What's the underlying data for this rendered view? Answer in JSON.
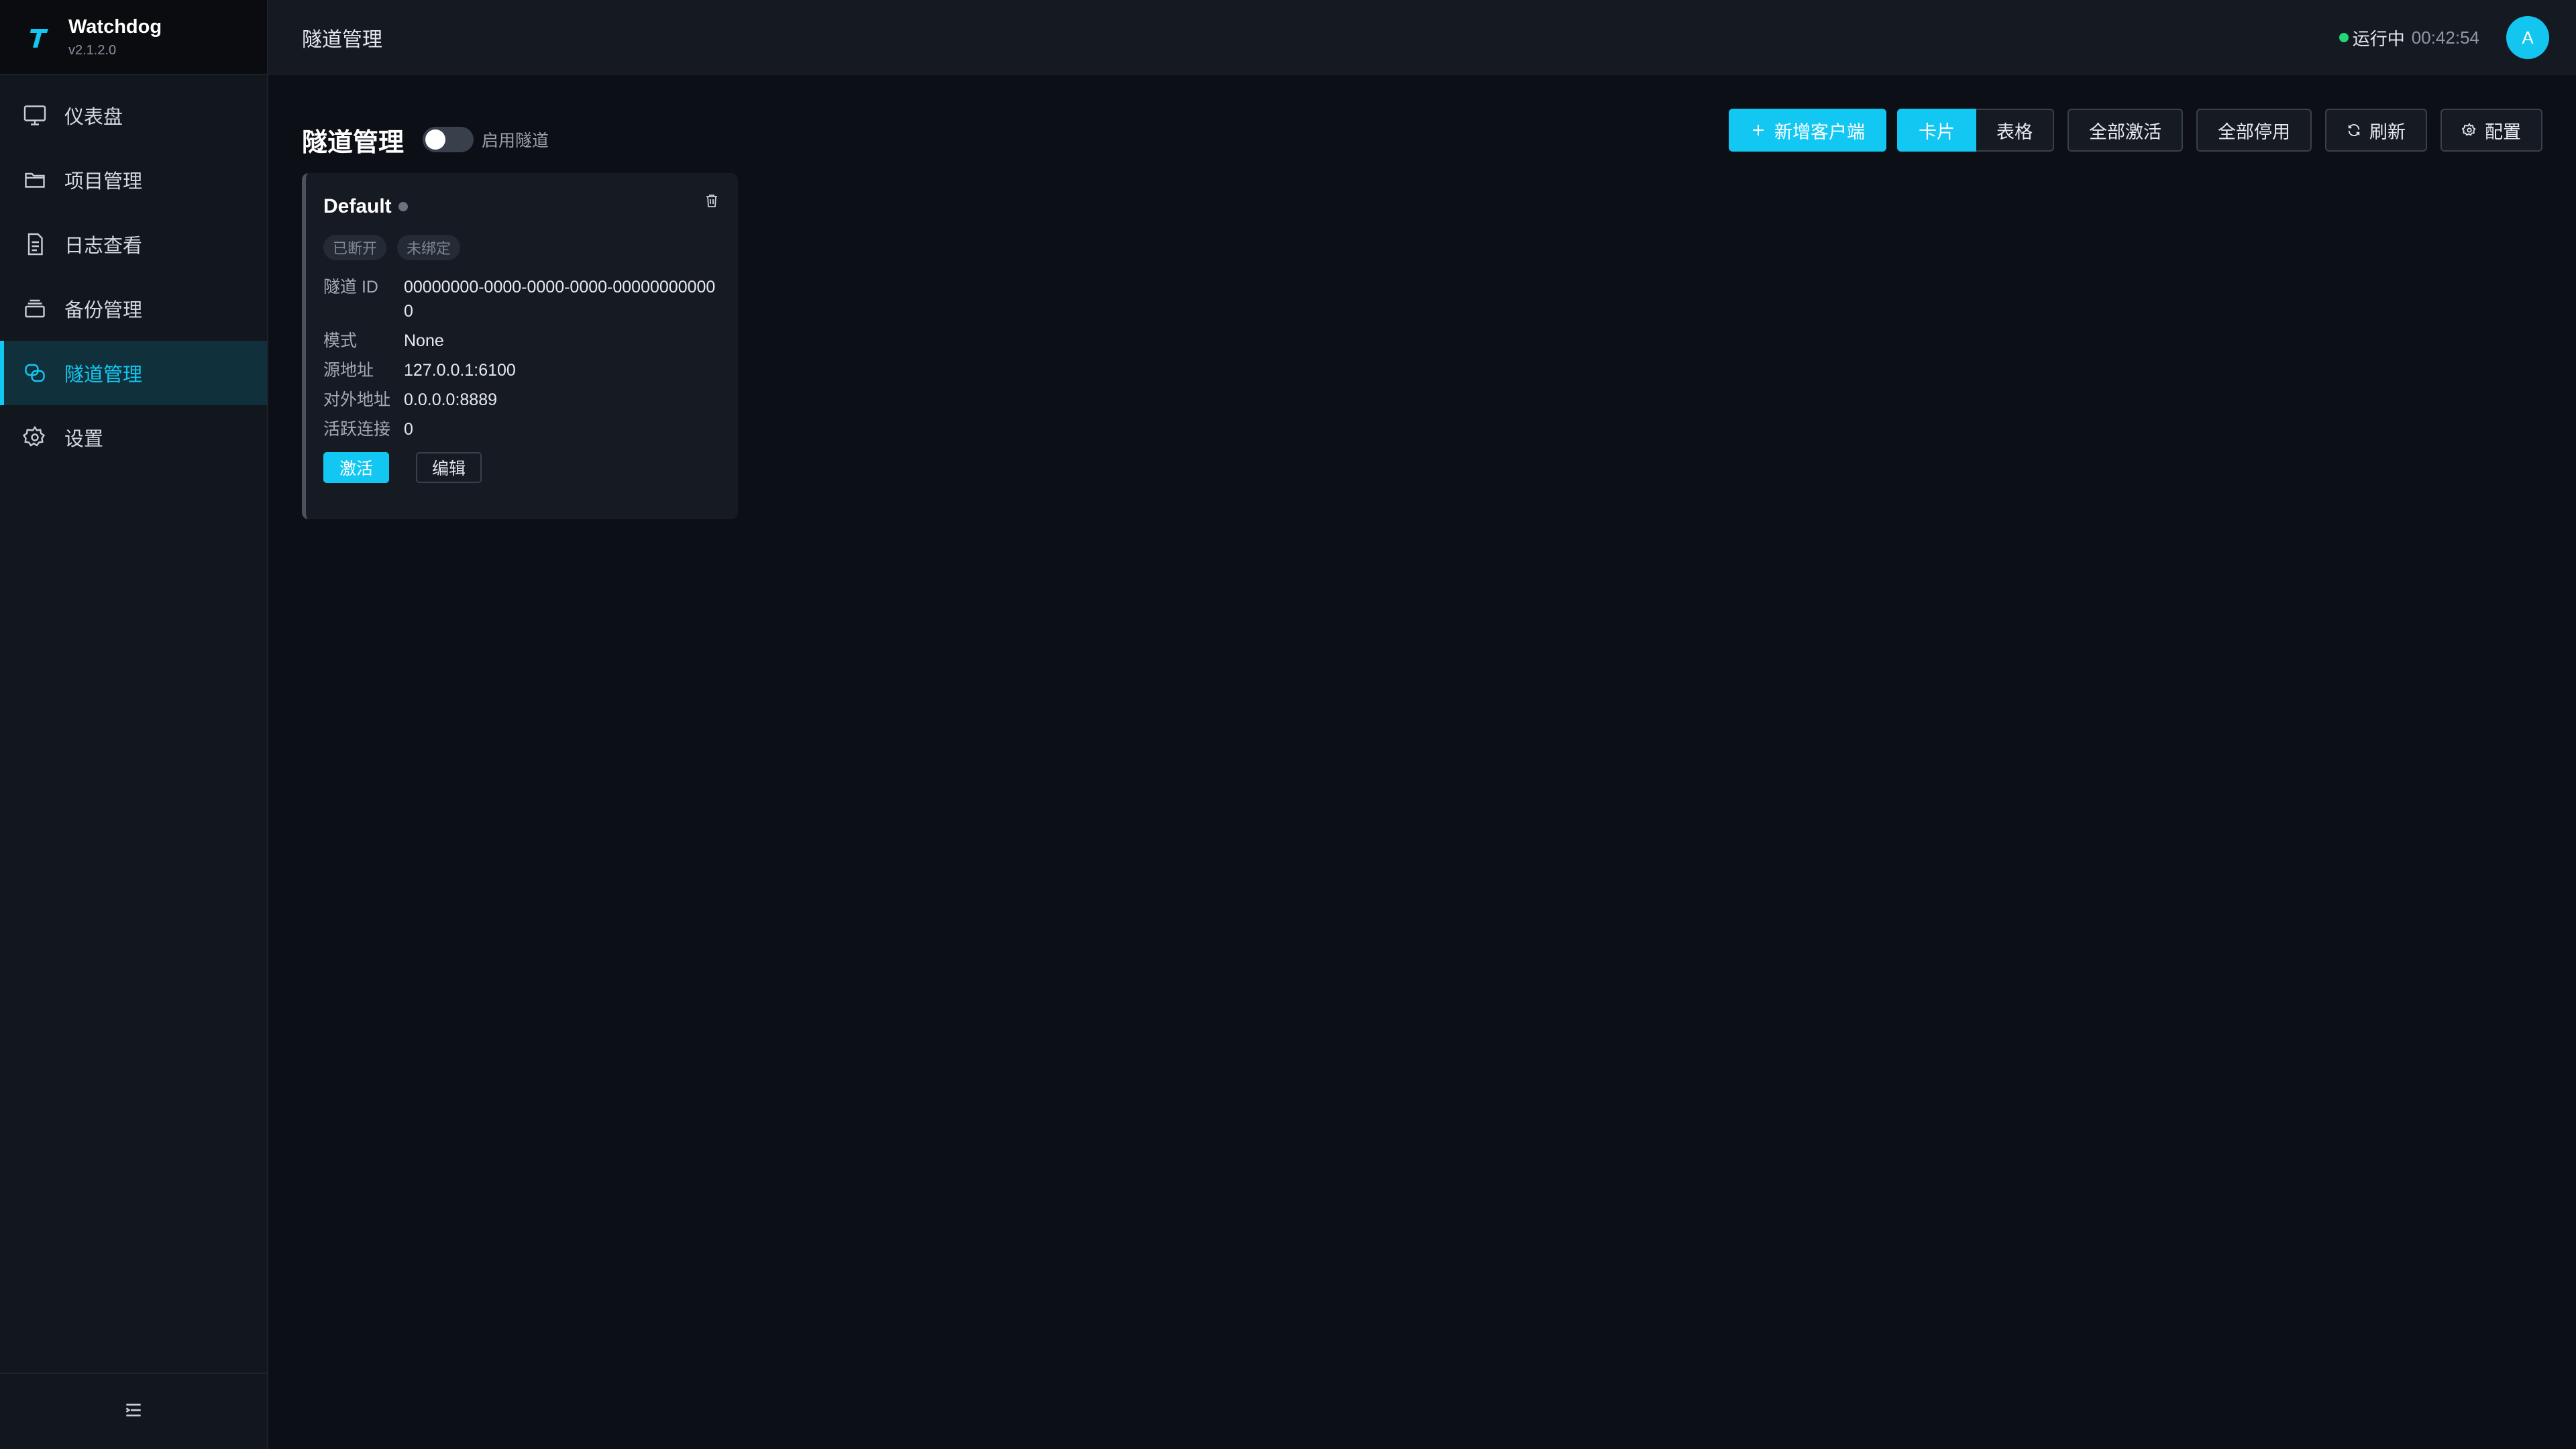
{
  "brand": {
    "name": "Watchdog",
    "version": "v2.1.2.0"
  },
  "sidebar": {
    "items": [
      {
        "label": "仪表盘",
        "icon": "monitor-icon"
      },
      {
        "label": "项目管理",
        "icon": "folder-icon"
      },
      {
        "label": "日志查看",
        "icon": "document-icon"
      },
      {
        "label": "备份管理",
        "icon": "layers-icon"
      },
      {
        "label": "隧道管理",
        "icon": "tunnel-icon",
        "active": true
      },
      {
        "label": "设置",
        "icon": "gear-icon"
      }
    ],
    "footer_icon": "collapse-menu-icon"
  },
  "topbar": {
    "title": "隧道管理",
    "status_label": "运行中",
    "status_time": "00:42:54",
    "avatar": "A"
  },
  "page": {
    "title": "隧道管理",
    "toggle_label": "启用隧道",
    "toggle_on": false
  },
  "toolbar": {
    "add_client": "新增客户端",
    "view_card": "卡片",
    "view_table": "表格",
    "activate_all": "全部激活",
    "deactivate_all": "全部停用",
    "refresh": "刷新",
    "config": "配置"
  },
  "card": {
    "title": "Default",
    "tags": [
      "已断开",
      "未绑定"
    ],
    "fields": [
      {
        "label": "隧道 ID",
        "value": "00000000-0000-0000-0000-000000000000"
      },
      {
        "label": "模式",
        "value": "None"
      },
      {
        "label": "源地址",
        "value": "127.0.0.1:6100"
      },
      {
        "label": "对外地址",
        "value": "0.0.0.0:8889"
      },
      {
        "label": "活跃连接",
        "value": "0"
      }
    ],
    "activate": "激活",
    "edit": "编辑"
  },
  "colors": {
    "accent": "#12c8f2",
    "status_ok": "#22d67a",
    "background": "#0c0f15",
    "sidebar": "#12161d"
  }
}
